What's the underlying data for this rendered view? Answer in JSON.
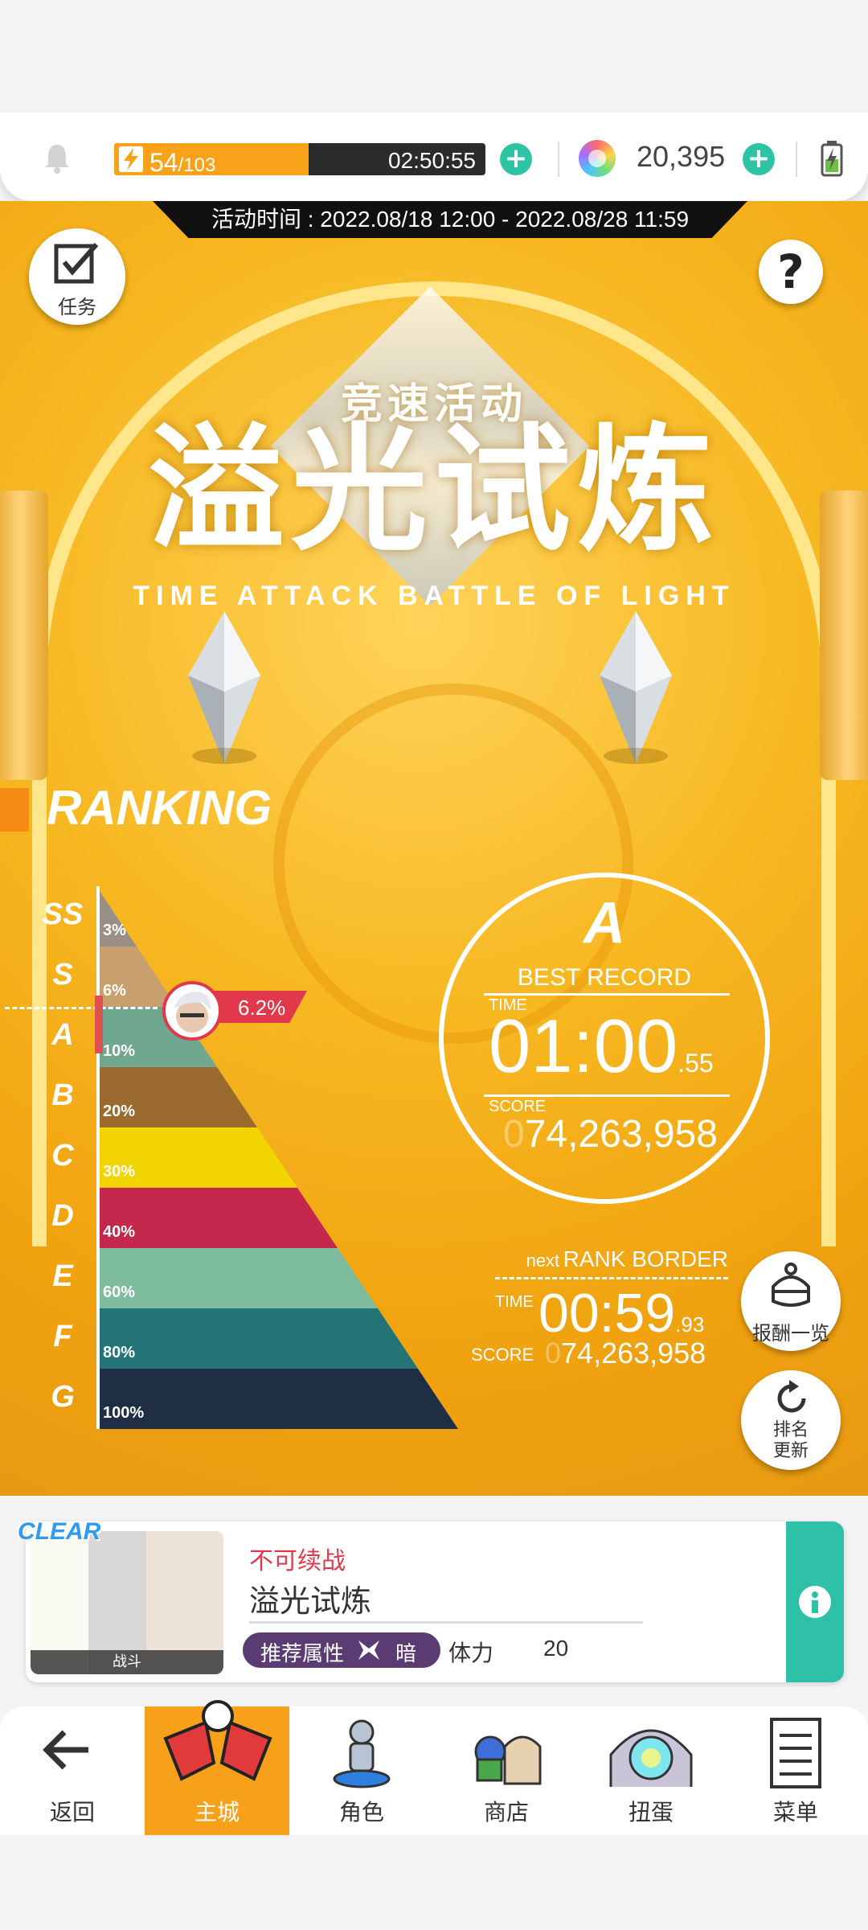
{
  "topbar": {
    "stamina_current": "54",
    "stamina_max": "/103",
    "stamina_fraction": 0.524,
    "stamina_timer": "02:50:55",
    "gems": "20,395"
  },
  "event_time": "活动时间 : 2022.08/18 12:00 - 2022.08/28 11:59",
  "mission_button": "任务",
  "help_button": "?",
  "title": {
    "small": "竞速活动",
    "main": "溢光试炼",
    "english": "TIME ATTACK BATTLE OF LIGHT"
  },
  "ranking": {
    "heading": "RANKING",
    "tiers": [
      {
        "rank": "SS",
        "pct": "3%",
        "color": "#9a8f87"
      },
      {
        "rank": "S",
        "pct": "6%",
        "color": "#c8a06d"
      },
      {
        "rank": "A",
        "pct": "10%",
        "color": "#6fa88f"
      },
      {
        "rank": "B",
        "pct": "20%",
        "color": "#9b6a2e"
      },
      {
        "rank": "C",
        "pct": "30%",
        "color": "#f2d500"
      },
      {
        "rank": "D",
        "pct": "40%",
        "color": "#c5264c"
      },
      {
        "rank": "E",
        "pct": "60%",
        "color": "#7dbd9d"
      },
      {
        "rank": "F",
        "pct": "80%",
        "color": "#237476"
      },
      {
        "rank": "G",
        "pct": "100%",
        "color": "#1f2e42"
      }
    ],
    "player_percent": "6.2%"
  },
  "best_record": {
    "rank": "A",
    "label": "BEST RECORD",
    "time_label": "TIME",
    "time_main": "01:00",
    "time_fraction": ".55",
    "score_label": "SCORE",
    "score_prefix": "0",
    "score": "74,263,958"
  },
  "next_border": {
    "next": "next",
    "label": "RANK BORDER",
    "time_label": "TIME",
    "time_main": "00:59",
    "time_fraction": ".93",
    "score_label": "SCORE",
    "score_prefix": "0",
    "score": "74,263,958"
  },
  "side_buttons": {
    "rewards": "报酬一览",
    "refresh_line1": "排名",
    "refresh_line2": "更新"
  },
  "stage_card": {
    "badge": "CLEAR",
    "thumb_label": "战斗",
    "status": "不可续战",
    "name": "溢光试炼",
    "recommend_label": "推荐属性",
    "element": "暗",
    "stamina_label": "体力",
    "stamina_cost": "20"
  },
  "nav": [
    {
      "label": "返回"
    },
    {
      "label": "主城"
    },
    {
      "label": "角色"
    },
    {
      "label": "商店"
    },
    {
      "label": "扭蛋"
    },
    {
      "label": "菜单"
    }
  ]
}
